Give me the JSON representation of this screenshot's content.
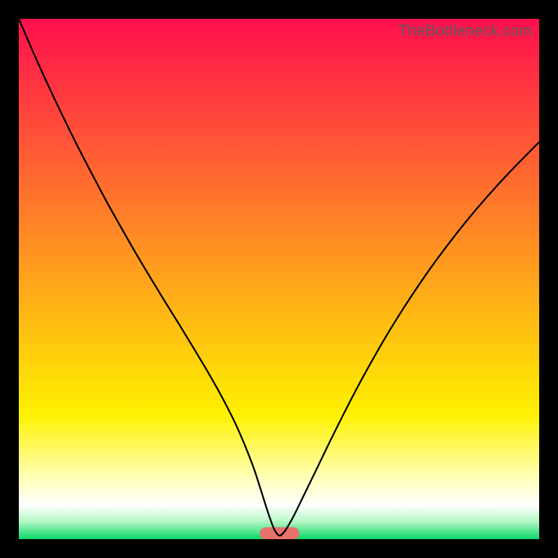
{
  "watermark": "TheBottleneck.com",
  "chart_data": {
    "type": "line",
    "title": "",
    "xlabel": "",
    "ylabel": "",
    "xlim": [
      0,
      100
    ],
    "ylim": [
      0,
      100
    ],
    "grid": false,
    "legend": false,
    "background_gradient": {
      "stops": [
        {
          "offset": 0.0,
          "color": "#ff0f4e"
        },
        {
          "offset": 0.47,
          "color": "#ff9a1f"
        },
        {
          "offset": 0.76,
          "color": "#fef100"
        },
        {
          "offset": 0.88,
          "color": "#ffffb5"
        },
        {
          "offset": 0.935,
          "color": "#ffffff"
        },
        {
          "offset": 0.965,
          "color": "#b8f8c7"
        },
        {
          "offset": 1.0,
          "color": "#0ad868"
        }
      ]
    },
    "marker": {
      "x_center": 50.1,
      "width": 7.6,
      "height": 2.4,
      "y": 1.1,
      "color": "#e6726b"
    },
    "series": [
      {
        "name": "curve",
        "color": "#000000",
        "x": [
          0.0,
          2.8,
          5.6,
          8.4,
          11.2,
          14.0,
          16.8,
          19.6,
          22.4,
          25.2,
          28.0,
          30.8,
          33.6,
          36.4,
          39.2,
          42.0,
          44.8,
          46.4,
          47.8,
          49.0,
          50.0,
          51.0,
          52.2,
          53.4,
          55.0,
          57.0,
          60.0,
          63.0,
          66.0,
          70.0,
          74.0,
          78.0,
          82.0,
          86.0,
          90.0,
          94.0,
          98.0,
          100.0
        ],
        "y": [
          100.0,
          93.5,
          87.3,
          81.4,
          75.7,
          70.3,
          65.0,
          60.0,
          55.1,
          50.4,
          45.8,
          41.3,
          36.7,
          32.0,
          27.0,
          21.4,
          14.6,
          9.8,
          5.4,
          2.1,
          0.7,
          1.4,
          3.3,
          5.6,
          8.9,
          13.0,
          19.2,
          25.2,
          30.9,
          38.0,
          44.5,
          50.5,
          56.0,
          61.1,
          65.8,
          70.2,
          74.3,
          76.3
        ]
      }
    ]
  }
}
